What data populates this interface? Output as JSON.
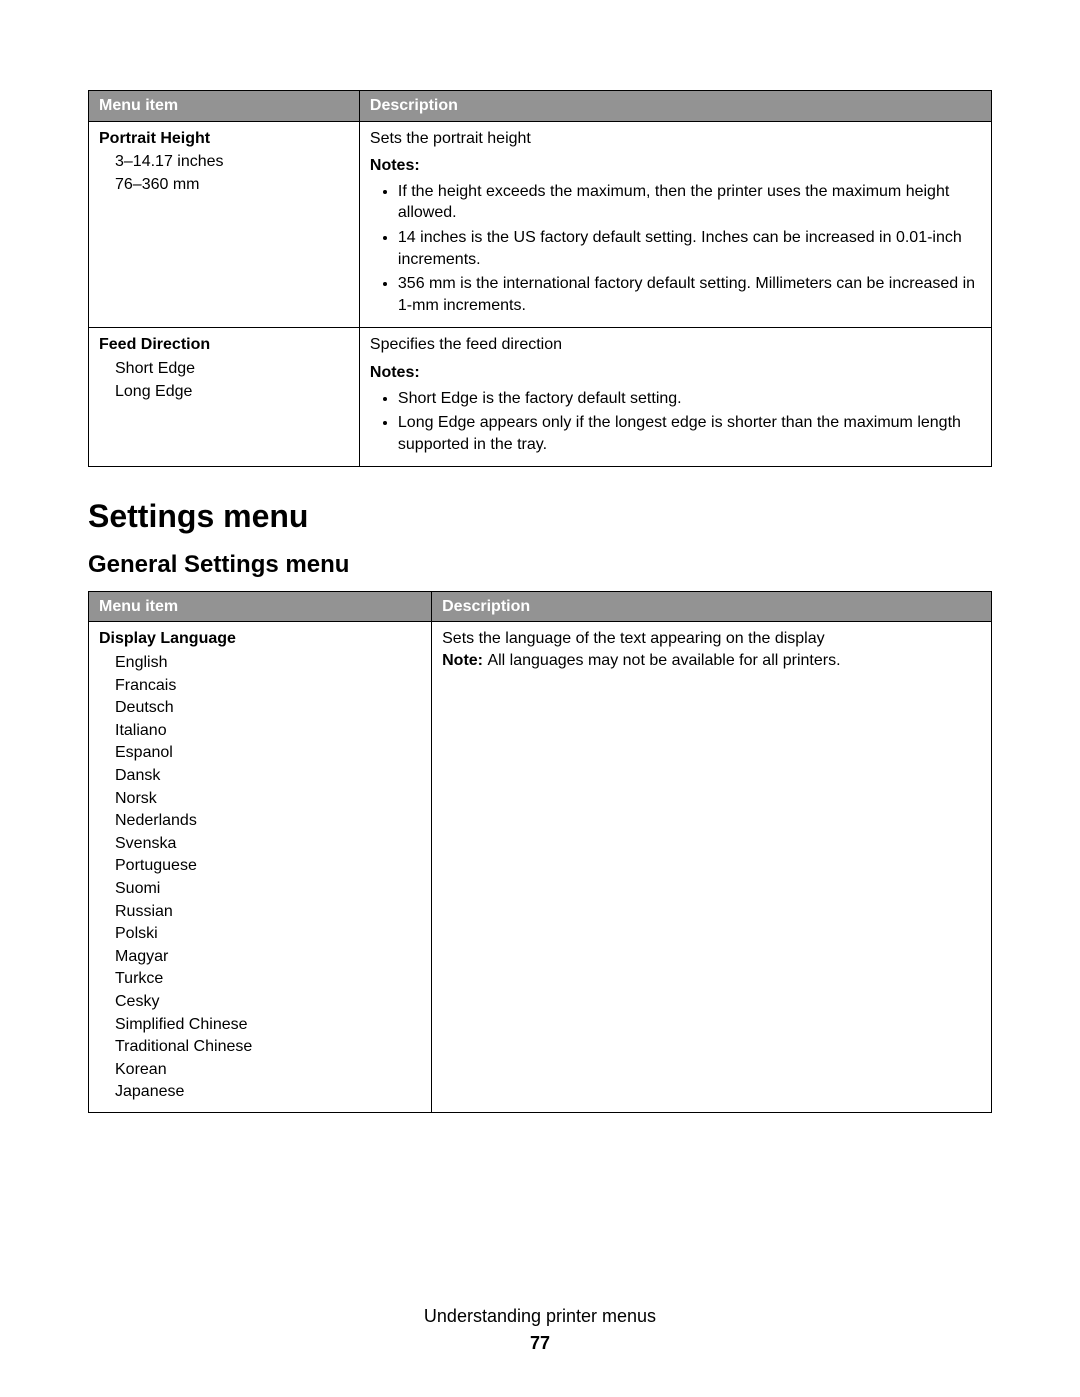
{
  "table1": {
    "headers": {
      "menu": "Menu item",
      "desc": "Description"
    },
    "rows": [
      {
        "title": "Portrait Height",
        "options": [
          "3–14.17 inches",
          "76–360 mm"
        ],
        "desc": "Sets the portrait height",
        "notes_label": "Notes:",
        "notes": [
          "If the height exceeds the maximum, then the printer uses the maximum height allowed.",
          "14 inches is the US factory default setting. Inches can be increased in 0.01-inch increments.",
          "356 mm is the international factory default setting. Millimeters can be increased in 1-mm increments."
        ]
      },
      {
        "title": "Feed Direction",
        "options": [
          "Short Edge",
          "Long Edge"
        ],
        "desc": "Specifies the feed direction",
        "notes_label": "Notes:",
        "notes": [
          "Short Edge is the factory default setting.",
          "Long Edge appears only if the longest edge is shorter than the maximum length supported in the tray."
        ]
      }
    ]
  },
  "section_heading": "Settings menu",
  "subsection_heading": "General Settings menu",
  "table2": {
    "headers": {
      "menu": "Menu item",
      "desc": "Description"
    },
    "rows": [
      {
        "title": "Display Language",
        "options": [
          "English",
          "Francais",
          "Deutsch",
          "Italiano",
          "Espanol",
          "Dansk",
          "Norsk",
          "Nederlands",
          "Svenska",
          "Portuguese",
          "Suomi",
          "Russian",
          "Polski",
          "Magyar",
          "Turkce",
          "Cesky",
          "Simplified Chinese",
          "Traditional Chinese",
          "Korean",
          "Japanese"
        ],
        "desc": "Sets the language of the text appearing on the display",
        "note_prefix": "Note: ",
        "note_text": "All languages may not be available for all printers."
      }
    ]
  },
  "footer": {
    "title": "Understanding printer menus",
    "page": "77"
  }
}
